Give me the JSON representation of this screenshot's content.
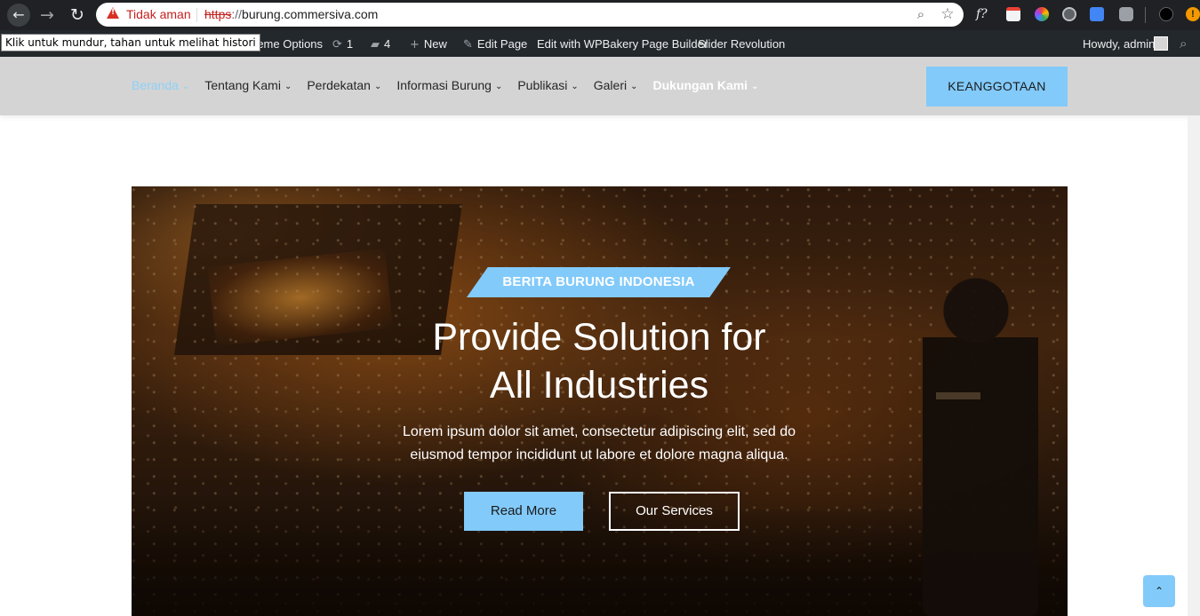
{
  "browser": {
    "security_label": "Tidak aman",
    "url_scheme": "https",
    "url_sep": "://",
    "url_host": "burung.commersiva.com",
    "back_tooltip": "Klik untuk mundur, tahan untuk melihat histori",
    "update_badge": "!"
  },
  "adminbar": {
    "theme_options": "Theme Options",
    "updates_count": "1",
    "comments_count": "4",
    "new_label": "New",
    "edit_page": "Edit Page",
    "edit_wpbakery": "Edit with WPBakery Page Builder",
    "slider_revolution": "Slider Revolution",
    "howdy": "Howdy, admin"
  },
  "header": {
    "menu": [
      {
        "label": "Beranda"
      },
      {
        "label": "Tentang Kami"
      },
      {
        "label": "Perdekatan"
      },
      {
        "label": "Informasi Burung"
      },
      {
        "label": "Publikasi"
      },
      {
        "label": "Galeri"
      },
      {
        "label": "Dukungan Kami"
      }
    ],
    "membership_button": "KEANGGOTAAN"
  },
  "hero": {
    "tag": "BERITA BURUNG INDONESIA",
    "title_line1": "Provide Solution for",
    "title_line2": "All Industries",
    "subtitle": "Lorem ipsum dolor sit amet, consectetur adipiscing elit, sed do eiusmod tempor incididunt ut labore et dolore magna aliqua.",
    "read_more": "Read More",
    "our_services": "Our Services"
  },
  "colors": {
    "accent": "#82cafa",
    "active_menu": "#8fd0f7",
    "header_bg": "#d4d4d4",
    "adminbar_bg": "#23282d"
  },
  "icons": {
    "back": "arrow-left-icon",
    "forward": "arrow-right-icon",
    "reload": "reload-icon",
    "warning": "warning-triangle-icon",
    "zoom": "zoom-icon",
    "bookmark": "star-icon",
    "scroll_top": "chevron-up-icon"
  }
}
